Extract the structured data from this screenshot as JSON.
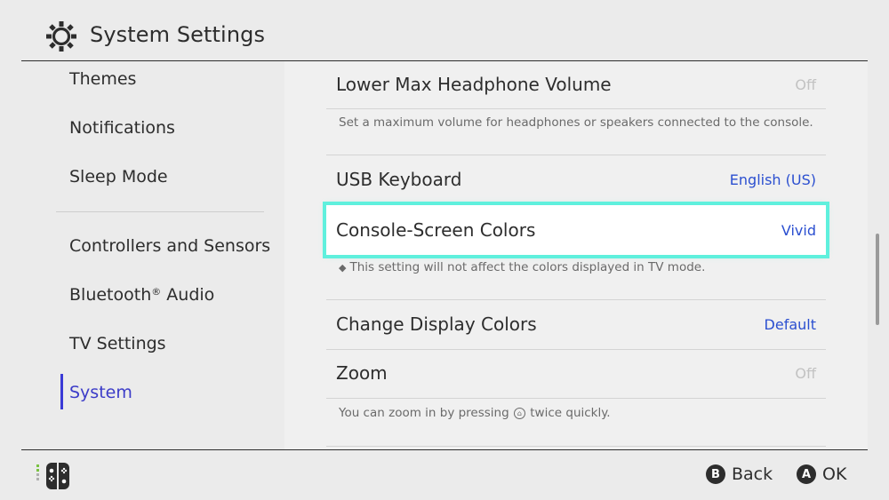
{
  "header": {
    "title": "System Settings",
    "icon": "gear-icon"
  },
  "sidebar": {
    "items": [
      {
        "label": "Themes"
      },
      {
        "label": "Notifications"
      },
      {
        "label": "Sleep Mode"
      },
      {
        "label": "Controllers and Sensors"
      },
      {
        "label_pre": "Bluetooth",
        "label_sup": "®",
        "label_post": " Audio"
      },
      {
        "label": "TV Settings"
      },
      {
        "label": "System",
        "active": true
      }
    ]
  },
  "main": {
    "headphone": {
      "label": "Lower Max Headphone Volume",
      "value": "Off",
      "desc": "Set a maximum volume for headphones or speakers connected to the console."
    },
    "usb_keyboard": {
      "label": "USB Keyboard",
      "value": "English (US)"
    },
    "screen_colors": {
      "label": "Console-Screen Colors",
      "value": "Vivid",
      "desc": "This setting will not affect the colors displayed in TV mode.",
      "bullet": "◆"
    },
    "display_colors": {
      "label": "Change Display Colors",
      "value": "Default"
    },
    "zoom": {
      "label": "Zoom",
      "value": "Off",
      "desc_pre": "You can zoom in by pressing",
      "desc_post": "twice quickly."
    }
  },
  "footer": {
    "back": {
      "key": "B",
      "label": "Back"
    },
    "ok": {
      "key": "A",
      "label": "OK"
    }
  },
  "colors": {
    "accent": "#3c3cc8",
    "highlight": "#5ff0dd",
    "value_blue": "#2b4fd0"
  }
}
